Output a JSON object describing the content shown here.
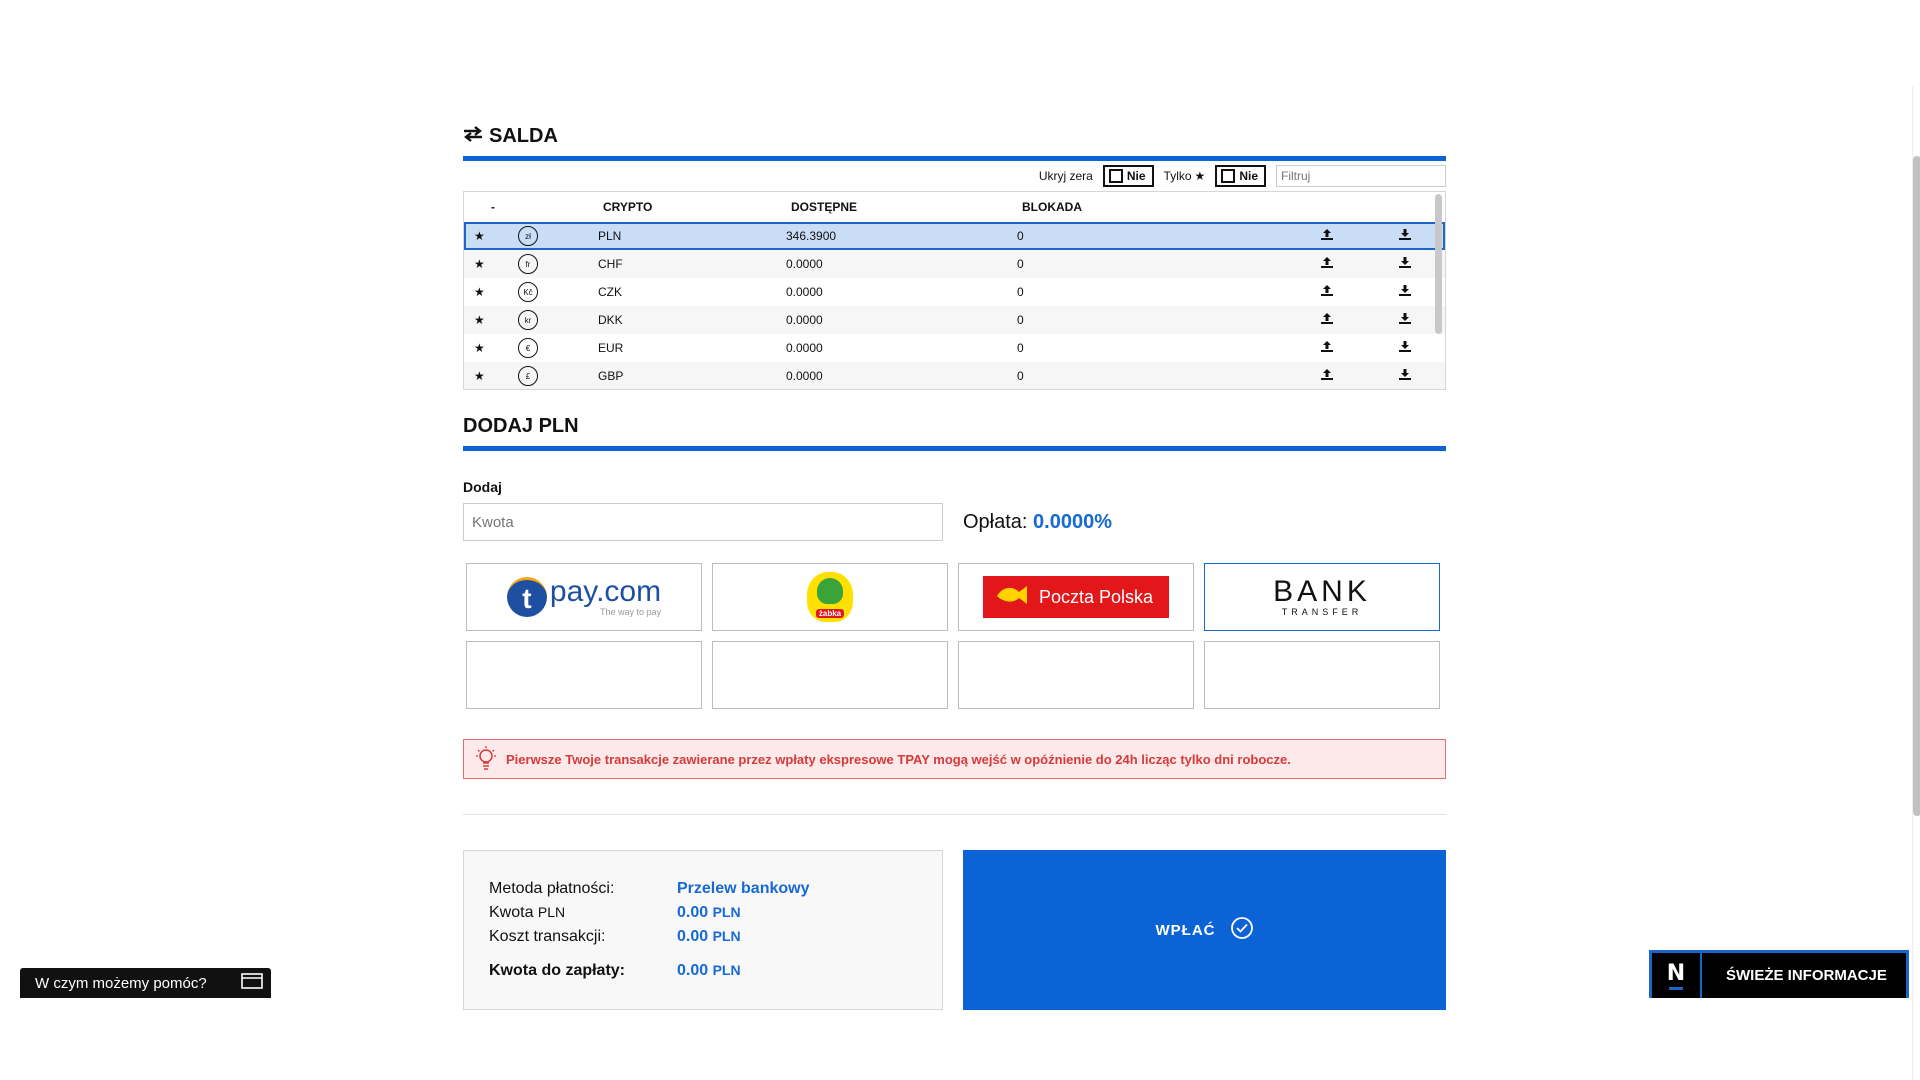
{
  "balances": {
    "title": "SALDA",
    "filters": {
      "hide_zeros_label": "Ukryj zera",
      "hide_zeros_value": "Nie",
      "only_label": "Tylko",
      "only_value": "Nie",
      "filter_placeholder": "Filtruj"
    },
    "columns": [
      "-",
      "CRYPTO",
      "DOSTĘPNE",
      "BLOKADA"
    ],
    "rows": [
      {
        "symbol": "zł",
        "code": "PLN",
        "available": "346.3900",
        "blocked": "0"
      },
      {
        "symbol": "fr",
        "code": "CHF",
        "available": "0.0000",
        "blocked": "0"
      },
      {
        "symbol": "Kč",
        "code": "CZK",
        "available": "0.0000",
        "blocked": "0"
      },
      {
        "symbol": "kr",
        "code": "DKK",
        "available": "0.0000",
        "blocked": "0"
      },
      {
        "symbol": "€",
        "code": "EUR",
        "available": "0.0000",
        "blocked": "0"
      },
      {
        "symbol": "£",
        "code": "GBP",
        "available": "0.0000",
        "blocked": "0"
      }
    ]
  },
  "deposit": {
    "title": "DODAJ PLN",
    "add_label": "Dodaj",
    "amount_placeholder": "Kwota",
    "fee_label": "Opłata:",
    "fee_value": "0.0000%",
    "methods": {
      "tpay_t": "t",
      "tpay_name": "pay.com",
      "tpay_tagline": "The way to pay",
      "zabka": "żabka",
      "poczta": "Poczta Polska",
      "bank_top": "BANK",
      "bank_bottom": "TRANSFER"
    },
    "notice": "Pierwsze Twoje transakcje zawierane przez wpłaty ekspresowe TPAY mogą wejść w opóźnienie do 24h licząc tylko dni robocze."
  },
  "summary": {
    "method_label": "Metoda płatności:",
    "method_value": "Przelew bankowy",
    "amount_label_main": "Kwota",
    "amount_label_currency": "PLN",
    "amount_value": "0.00",
    "amount_currency": "PLN",
    "cost_label": "Koszt transakcji:",
    "cost_value": "0.00",
    "cost_currency": "PLN",
    "total_label": "Kwota do zapłaty:",
    "total_value": "0.00",
    "total_currency": "PLN"
  },
  "pay_button": "WPŁAĆ",
  "chat_widget": "W czym możemy pomóc?",
  "news_widget": {
    "logo": "N",
    "label": "ŚWIEŻE INFORMACJE"
  },
  "colors": {
    "accent": "#0b63d5",
    "selected_row": "#c9ddf6",
    "notice_red": "#d63a3a"
  }
}
